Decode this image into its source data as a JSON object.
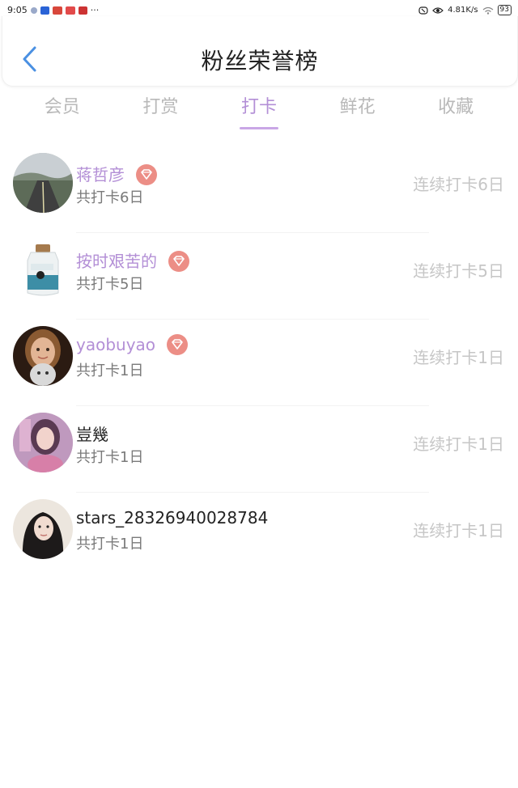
{
  "status_bar": {
    "time": "9:05",
    "more": "···",
    "net_speed": "4.81K/s",
    "battery": "93"
  },
  "header": {
    "title": "粉丝荣誉榜"
  },
  "tabs": [
    {
      "label": "会员",
      "active": false
    },
    {
      "label": "打赏",
      "active": false
    },
    {
      "label": "打卡",
      "active": true
    },
    {
      "label": "鲜花",
      "active": false
    },
    {
      "label": "收藏",
      "active": false
    }
  ],
  "colors": {
    "accent": "#b38fd6",
    "badge": "#ec8e86",
    "back_arrow": "#4a90e2"
  },
  "fans": [
    {
      "name": "蒋哲彦",
      "member": true,
      "total": "共打卡6日",
      "streak": "连续打卡6日"
    },
    {
      "name": "按时艰苦的",
      "member": true,
      "total": "共打卡5日",
      "streak": "连续打卡5日"
    },
    {
      "name": "yaobuyao",
      "member": true,
      "total": "共打卡1日",
      "streak": "连续打卡1日"
    },
    {
      "name": "豈幾",
      "member": false,
      "total": "共打卡1日",
      "streak": "连续打卡1日"
    },
    {
      "name": "stars_28326940028784",
      "member": false,
      "total": "共打卡1日",
      "streak": "连续打卡1日"
    }
  ]
}
